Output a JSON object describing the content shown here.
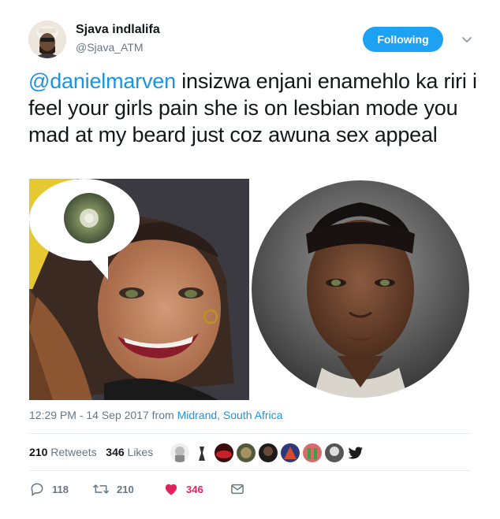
{
  "user": {
    "name": "Sjava indlalifa",
    "handle": "@Sjava_ATM"
  },
  "follow_label": "Following",
  "tweet": {
    "mention": "@danielmarven",
    "body": " insizwa enjani enamehlo ka riri i feel your girls pain she is  on lesbian mode you mad at my beard just coz awuna sex appeal"
  },
  "meta": {
    "time": "12:29 PM - 14 Sep 2017",
    "from_word": "from",
    "location": "Midrand, South Africa"
  },
  "stats": {
    "retweets_count": "210",
    "retweets_label": "Retweets",
    "likes_count": "346",
    "likes_label": "Likes"
  },
  "actions": {
    "reply_count": "118",
    "retweet_count": "210",
    "like_count": "346"
  },
  "colors": {
    "accent": "#1da1f2",
    "link": "#1b95e0",
    "like": "#e0245e",
    "muted": "#657786"
  },
  "icons": [
    "chevron-down-icon",
    "reply-icon",
    "retweet-icon",
    "heart-icon",
    "message-icon",
    "twitter-bird-icon"
  ]
}
